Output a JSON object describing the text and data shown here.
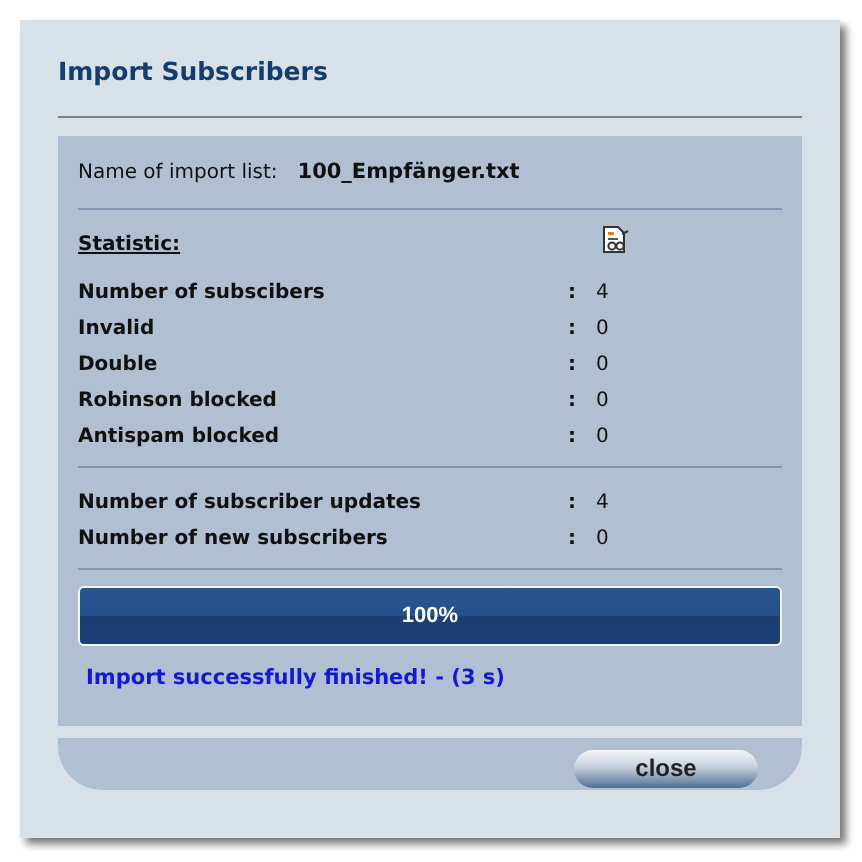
{
  "dialog": {
    "title": "Import Subscribers"
  },
  "import_list": {
    "label": "Name of import list:",
    "value": "100_Empfänger.txt"
  },
  "statistic": {
    "heading": "Statistic:",
    "groups": [
      [
        {
          "label": "Number of subscibers",
          "separator": ":",
          "value": "4"
        },
        {
          "label": "Invalid",
          "separator": ":",
          "value": "0"
        },
        {
          "label": "Double",
          "separator": ":",
          "value": "0"
        },
        {
          "label": "Robinson blocked",
          "separator": ":",
          "value": "0"
        },
        {
          "label": "Antispam blocked",
          "separator": ":",
          "value": "0"
        }
      ],
      [
        {
          "label": "Number of subscriber updates",
          "separator": ":",
          "value": "4"
        },
        {
          "label": "Number of new subscribers",
          "separator": ":",
          "value": "0"
        }
      ]
    ]
  },
  "progress": {
    "level": 1,
    "text": "100%"
  },
  "message": "Import successfully finished! - (3 s)",
  "buttons": [
    {
      "label": "close"
    }
  ]
}
